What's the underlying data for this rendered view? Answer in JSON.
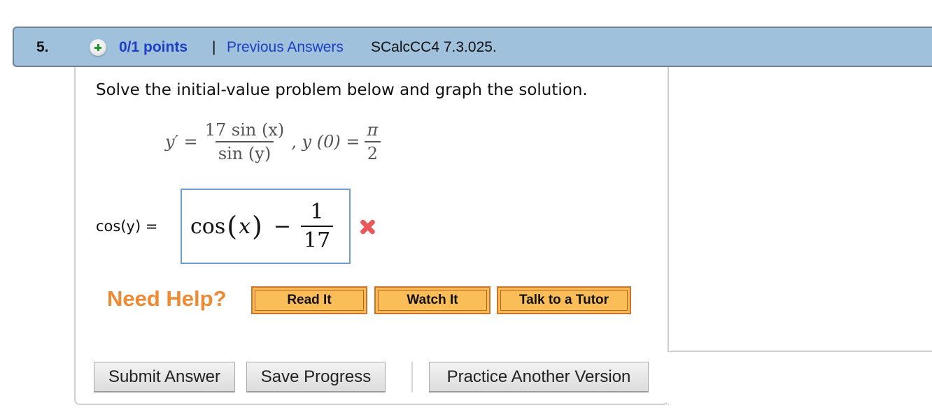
{
  "question": {
    "number": "5.",
    "points": "0/1 points",
    "separator": "|",
    "previous_answers_label": "Previous Answers",
    "source": "SCalcCC4 7.3.025.",
    "expand_icon": "plus-circle-icon"
  },
  "problem": {
    "prompt": "Solve the initial-value problem below and graph the solution.",
    "equation": {
      "lhs": "y′ =",
      "numerator": "17 sin (x)",
      "denominator": "sin (y)",
      "condition_lhs": ", y (0) =",
      "condition_num": "π",
      "condition_den": "2"
    }
  },
  "answer": {
    "label": "cos(y) =",
    "value": {
      "func": "cos",
      "open_paren": "(",
      "var": "x",
      "close_paren": ")",
      "minus": "−",
      "frac_num": "1",
      "frac_den": "17"
    },
    "status": "incorrect",
    "status_icon": "red-x-icon"
  },
  "help": {
    "heading": "Need Help?",
    "buttons": [
      "Read It",
      "Watch It",
      "Talk to a Tutor"
    ]
  },
  "actions": {
    "submit": "Submit Answer",
    "save": "Save Progress",
    "practice": "Practice Another Version"
  }
}
